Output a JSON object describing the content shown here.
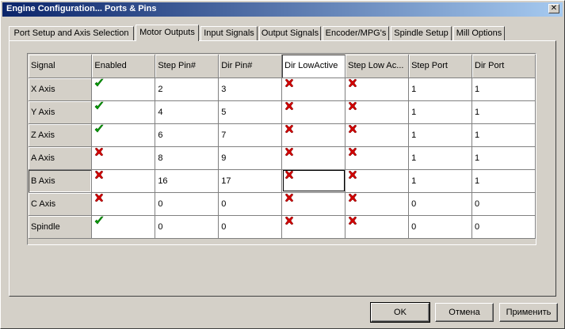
{
  "window": {
    "title": "Engine Configuration... Ports & Pins",
    "close_glyph": "✕"
  },
  "tabs": [
    {
      "label": "Port Setup and Axis Selection",
      "active": false
    },
    {
      "label": "Motor Outputs",
      "active": true
    },
    {
      "label": "Input Signals",
      "active": false
    },
    {
      "label": "Output Signals",
      "active": false
    },
    {
      "label": "Encoder/MPG's",
      "active": false
    },
    {
      "label": "Spindle Setup",
      "active": false
    },
    {
      "label": "Mill Options",
      "active": false
    }
  ],
  "grid": {
    "columns": [
      "Signal",
      "Enabled",
      "Step Pin#",
      "Dir Pin#",
      "Dir LowActive",
      "Step Low Ac...",
      "Step Port",
      "Dir Port"
    ],
    "rows": [
      {
        "signal": "X Axis",
        "enabled": "check",
        "step_pin": "2",
        "dir_pin": "3",
        "dir_low_active": "cross",
        "step_low_active": "cross",
        "step_port": "1",
        "dir_port": "1"
      },
      {
        "signal": "Y Axis",
        "enabled": "check",
        "step_pin": "4",
        "dir_pin": "5",
        "dir_low_active": "cross",
        "step_low_active": "cross",
        "step_port": "1",
        "dir_port": "1"
      },
      {
        "signal": "Z Axis",
        "enabled": "check",
        "step_pin": "6",
        "dir_pin": "7",
        "dir_low_active": "cross",
        "step_low_active": "cross",
        "step_port": "1",
        "dir_port": "1"
      },
      {
        "signal": "A Axis",
        "enabled": "cross",
        "step_pin": "8",
        "dir_pin": "9",
        "dir_low_active": "cross",
        "step_low_active": "cross",
        "step_port": "1",
        "dir_port": "1"
      },
      {
        "signal": "B Axis",
        "enabled": "cross",
        "step_pin": "16",
        "dir_pin": "17",
        "dir_low_active": "cross",
        "step_low_active": "cross",
        "step_port": "1",
        "dir_port": "1"
      },
      {
        "signal": "C Axis",
        "enabled": "cross",
        "step_pin": "0",
        "dir_pin": "0",
        "dir_low_active": "cross",
        "step_low_active": "cross",
        "step_port": "0",
        "dir_port": "0"
      },
      {
        "signal": "Spindle",
        "enabled": "check",
        "step_pin": "0",
        "dir_pin": "0",
        "dir_low_active": "cross",
        "step_low_active": "cross",
        "step_port": "0",
        "dir_port": "0"
      }
    ],
    "active_row": "B Axis",
    "active_column": "Dir LowActive"
  },
  "buttons": {
    "ok": "OK",
    "cancel": "Отмена",
    "apply": "Применить"
  },
  "colors": {
    "check": "#00a000",
    "cross": "#d00000",
    "title_start": "#0a246a",
    "title_end": "#a6caf0"
  }
}
